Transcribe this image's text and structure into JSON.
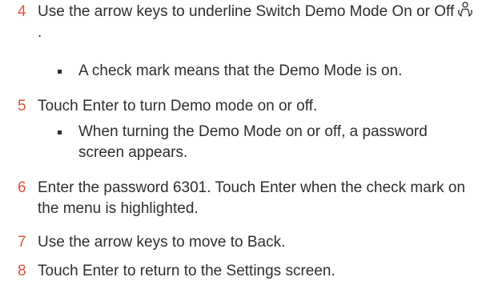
{
  "steps": [
    {
      "number": "4",
      "text_before_icon": "Use the arrow keys to underline Switch Demo Mode On or Off",
      "text_after_icon": ".",
      "icon": "demo-mode-person-icon",
      "bullets": [
        "A check mark means that the Demo Mode is on."
      ]
    },
    {
      "number": "5",
      "text": "Touch Enter to turn Demo mode on or off.",
      "bullets": [
        "When turning the Demo Mode on or off, a password screen appears."
      ]
    },
    {
      "number": "6",
      "text": "Enter the password 6301. Touch Enter when the check mark on the menu is highlighted."
    },
    {
      "number": "7",
      "text": "Use the arrow keys to move to Back."
    },
    {
      "number": "8",
      "text": "Touch Enter to return to the Settings screen."
    }
  ],
  "colors": {
    "step_number": "#e0503c",
    "text": "#2e2e2e"
  }
}
